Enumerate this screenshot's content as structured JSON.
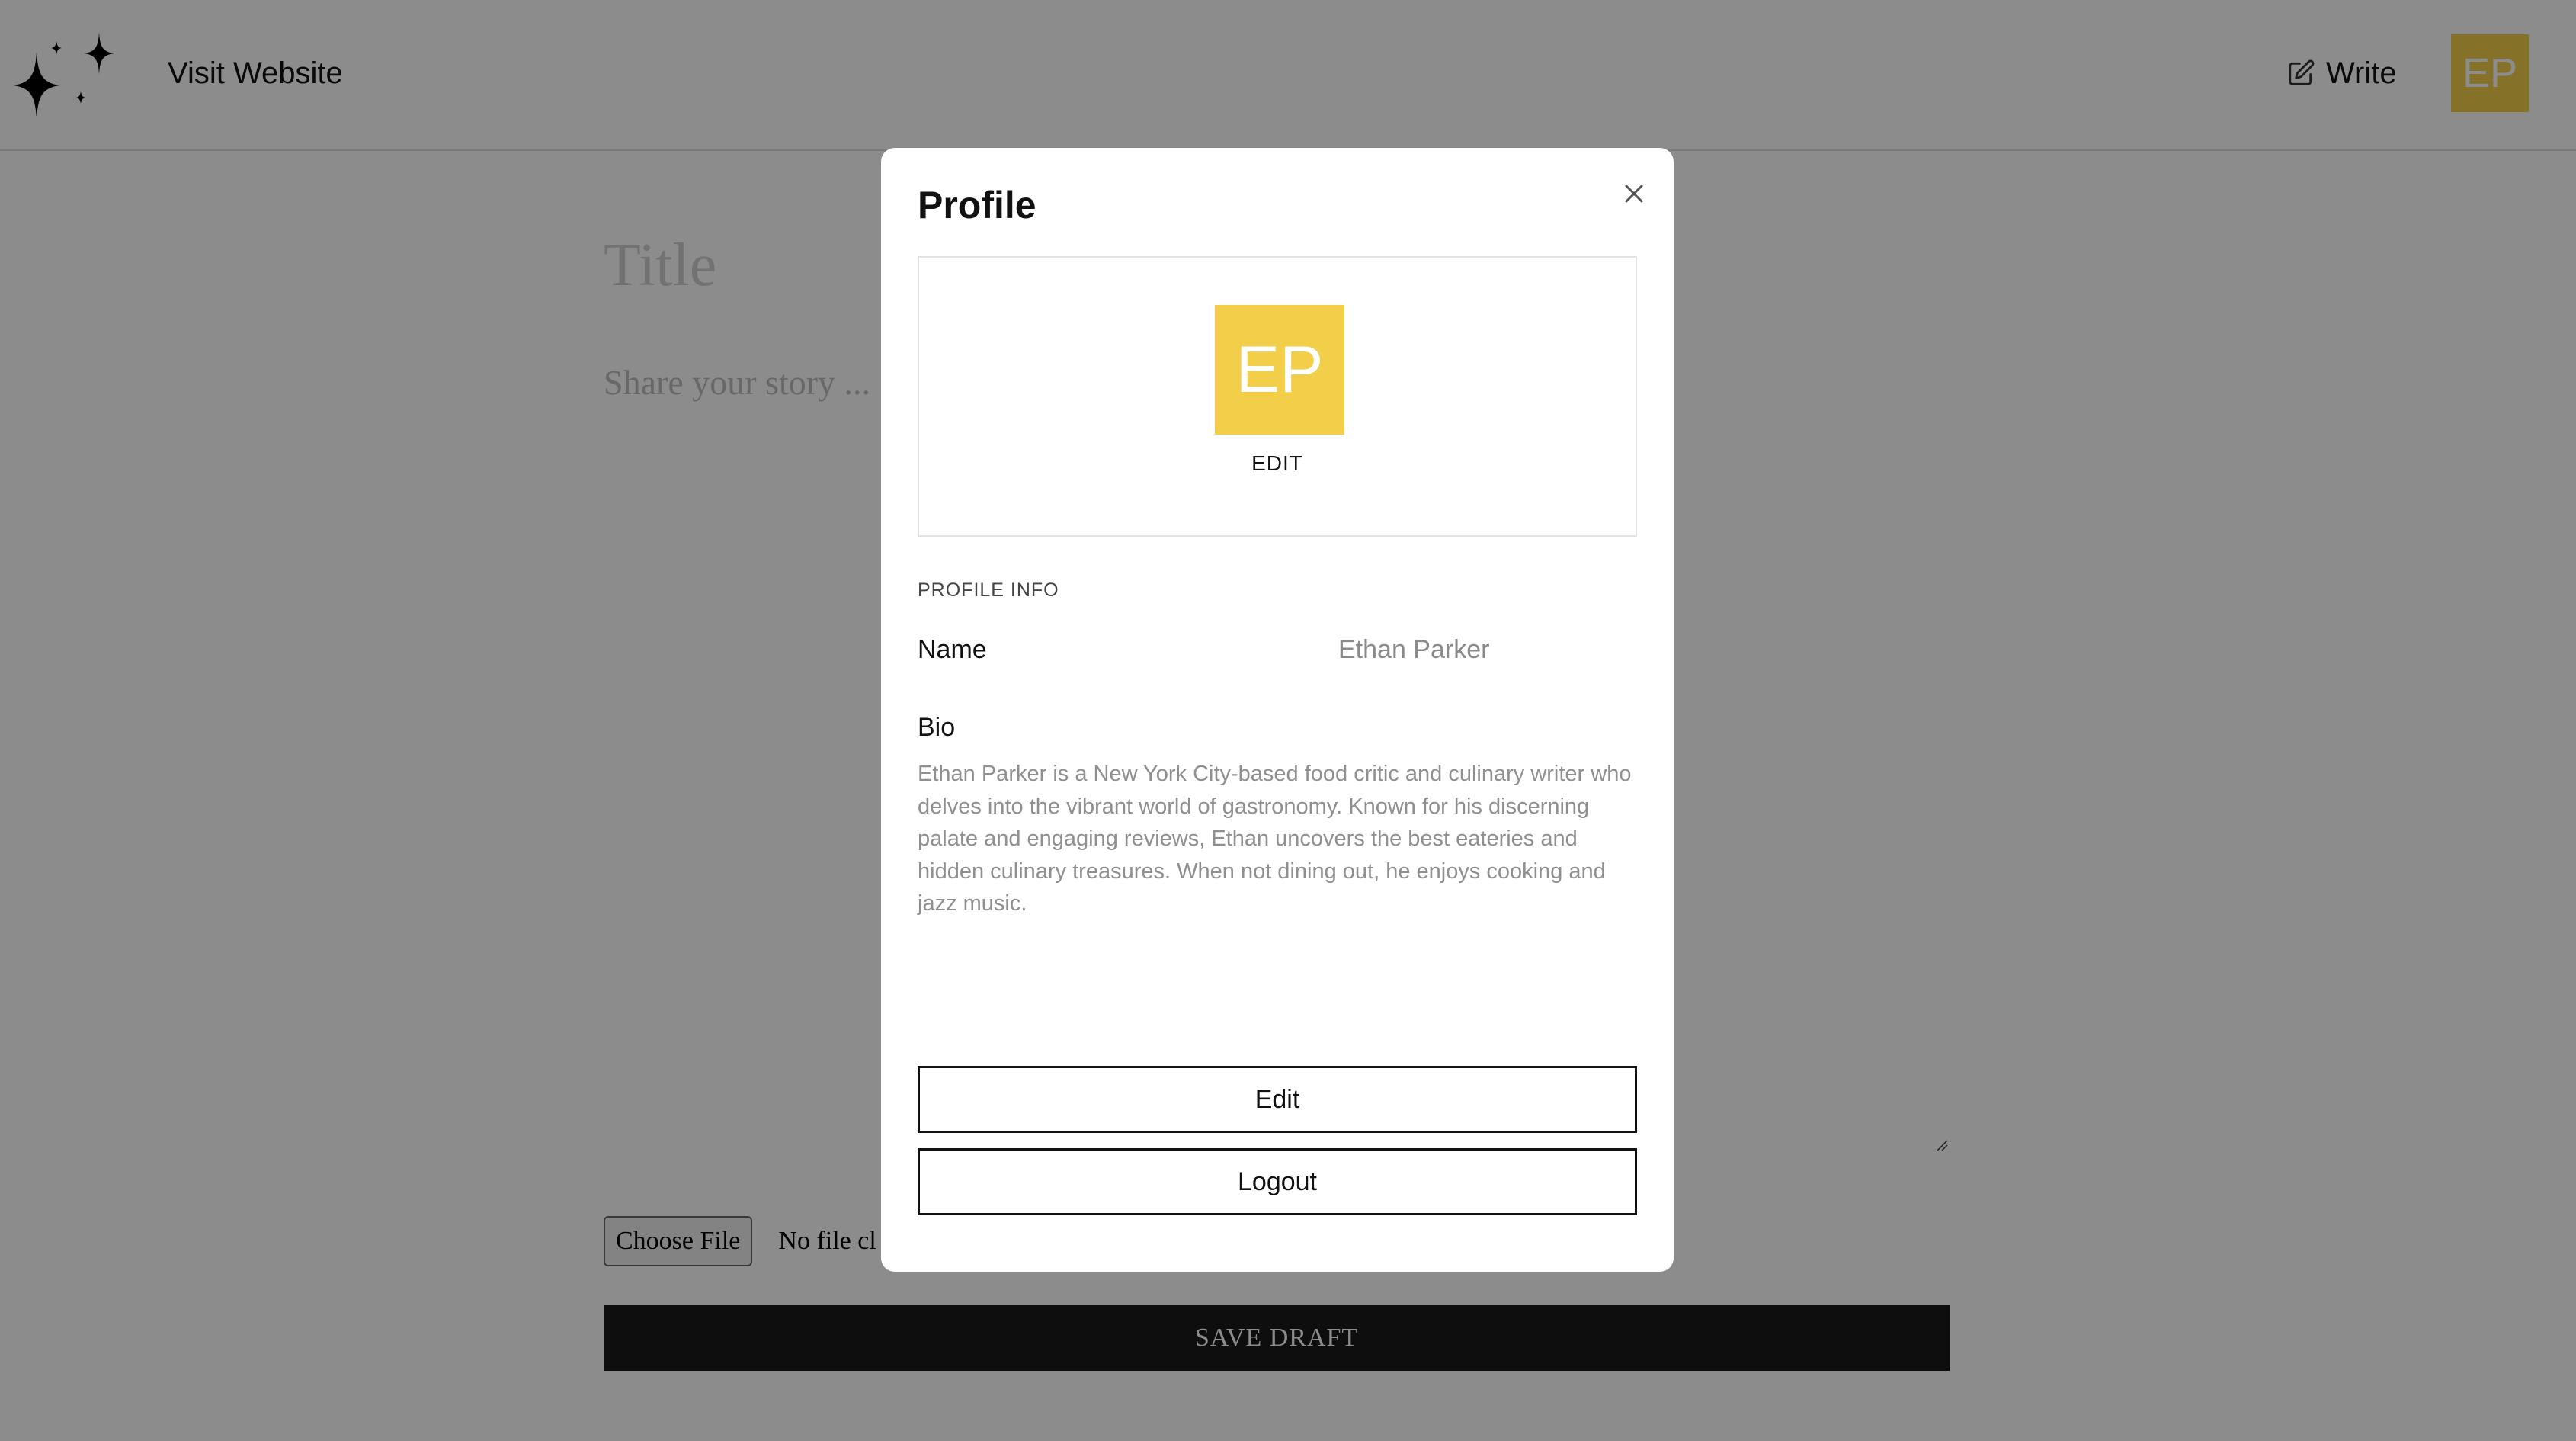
{
  "header": {
    "visit_label": "Visit Website",
    "write_label": "Write",
    "avatar_initials": "EP"
  },
  "editor": {
    "title_placeholder": "Title",
    "story_placeholder": "Share your story ...",
    "choose_file_label": "Choose File",
    "no_file_text": "No file cl",
    "save_draft_label": "SAVE DRAFT"
  },
  "modal": {
    "title": "Profile",
    "avatar_initials": "EP",
    "avatar_edit_label": "EDIT",
    "section_label": "PROFILE INFO",
    "name_label": "Name",
    "name_value": "Ethan Parker",
    "bio_label": "Bio",
    "bio_value": "Ethan Parker is a New York City-based food critic and culinary writer who delves into the vibrant world of gastronomy. Known for his discerning palate and engaging reviews, Ethan uncovers the best eateries and hidden culinary treasures. When not dining out, he enjoys cooking and jazz music.",
    "edit_button": "Edit",
    "logout_button": "Logout"
  },
  "colors": {
    "avatar_bg": "#f3cf49",
    "overlay": "rgba(0,0,0,0.45)",
    "primary_button": "#1a1a1a"
  },
  "icons": {
    "logo": "sparkles-icon",
    "write": "edit-pencil-icon",
    "close": "close-icon"
  }
}
